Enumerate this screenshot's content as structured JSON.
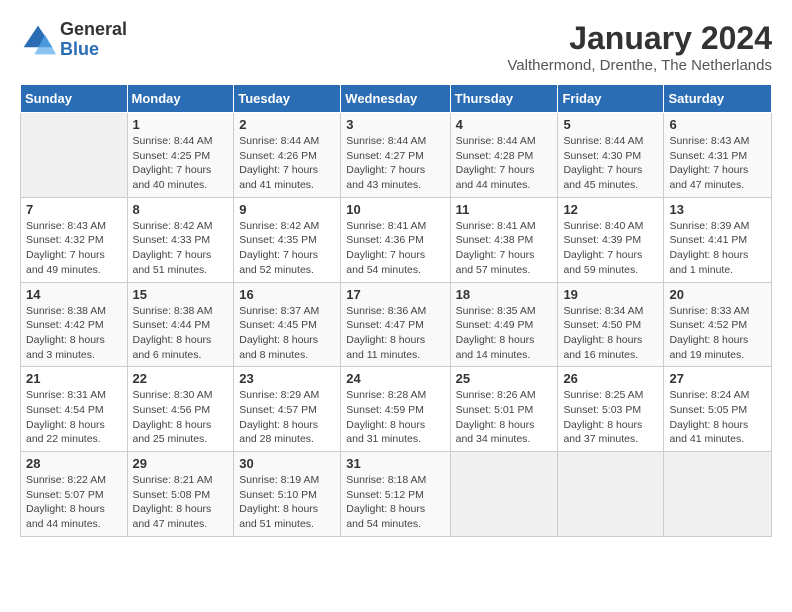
{
  "logo": {
    "general": "General",
    "blue": "Blue"
  },
  "title": "January 2024",
  "location": "Valthermond, Drenthe, The Netherlands",
  "days_of_week": [
    "Sunday",
    "Monday",
    "Tuesday",
    "Wednesday",
    "Thursday",
    "Friday",
    "Saturday"
  ],
  "weeks": [
    [
      {
        "day": "",
        "sunrise": "",
        "sunset": "",
        "daylight": ""
      },
      {
        "day": "1",
        "sunrise": "Sunrise: 8:44 AM",
        "sunset": "Sunset: 4:25 PM",
        "daylight": "Daylight: 7 hours and 40 minutes."
      },
      {
        "day": "2",
        "sunrise": "Sunrise: 8:44 AM",
        "sunset": "Sunset: 4:26 PM",
        "daylight": "Daylight: 7 hours and 41 minutes."
      },
      {
        "day": "3",
        "sunrise": "Sunrise: 8:44 AM",
        "sunset": "Sunset: 4:27 PM",
        "daylight": "Daylight: 7 hours and 43 minutes."
      },
      {
        "day": "4",
        "sunrise": "Sunrise: 8:44 AM",
        "sunset": "Sunset: 4:28 PM",
        "daylight": "Daylight: 7 hours and 44 minutes."
      },
      {
        "day": "5",
        "sunrise": "Sunrise: 8:44 AM",
        "sunset": "Sunset: 4:30 PM",
        "daylight": "Daylight: 7 hours and 45 minutes."
      },
      {
        "day": "6",
        "sunrise": "Sunrise: 8:43 AM",
        "sunset": "Sunset: 4:31 PM",
        "daylight": "Daylight: 7 hours and 47 minutes."
      }
    ],
    [
      {
        "day": "7",
        "sunrise": "Sunrise: 8:43 AM",
        "sunset": "Sunset: 4:32 PM",
        "daylight": "Daylight: 7 hours and 49 minutes."
      },
      {
        "day": "8",
        "sunrise": "Sunrise: 8:42 AM",
        "sunset": "Sunset: 4:33 PM",
        "daylight": "Daylight: 7 hours and 51 minutes."
      },
      {
        "day": "9",
        "sunrise": "Sunrise: 8:42 AM",
        "sunset": "Sunset: 4:35 PM",
        "daylight": "Daylight: 7 hours and 52 minutes."
      },
      {
        "day": "10",
        "sunrise": "Sunrise: 8:41 AM",
        "sunset": "Sunset: 4:36 PM",
        "daylight": "Daylight: 7 hours and 54 minutes."
      },
      {
        "day": "11",
        "sunrise": "Sunrise: 8:41 AM",
        "sunset": "Sunset: 4:38 PM",
        "daylight": "Daylight: 7 hours and 57 minutes."
      },
      {
        "day": "12",
        "sunrise": "Sunrise: 8:40 AM",
        "sunset": "Sunset: 4:39 PM",
        "daylight": "Daylight: 7 hours and 59 minutes."
      },
      {
        "day": "13",
        "sunrise": "Sunrise: 8:39 AM",
        "sunset": "Sunset: 4:41 PM",
        "daylight": "Daylight: 8 hours and 1 minute."
      }
    ],
    [
      {
        "day": "14",
        "sunrise": "Sunrise: 8:38 AM",
        "sunset": "Sunset: 4:42 PM",
        "daylight": "Daylight: 8 hours and 3 minutes."
      },
      {
        "day": "15",
        "sunrise": "Sunrise: 8:38 AM",
        "sunset": "Sunset: 4:44 PM",
        "daylight": "Daylight: 8 hours and 6 minutes."
      },
      {
        "day": "16",
        "sunrise": "Sunrise: 8:37 AM",
        "sunset": "Sunset: 4:45 PM",
        "daylight": "Daylight: 8 hours and 8 minutes."
      },
      {
        "day": "17",
        "sunrise": "Sunrise: 8:36 AM",
        "sunset": "Sunset: 4:47 PM",
        "daylight": "Daylight: 8 hours and 11 minutes."
      },
      {
        "day": "18",
        "sunrise": "Sunrise: 8:35 AM",
        "sunset": "Sunset: 4:49 PM",
        "daylight": "Daylight: 8 hours and 14 minutes."
      },
      {
        "day": "19",
        "sunrise": "Sunrise: 8:34 AM",
        "sunset": "Sunset: 4:50 PM",
        "daylight": "Daylight: 8 hours and 16 minutes."
      },
      {
        "day": "20",
        "sunrise": "Sunrise: 8:33 AM",
        "sunset": "Sunset: 4:52 PM",
        "daylight": "Daylight: 8 hours and 19 minutes."
      }
    ],
    [
      {
        "day": "21",
        "sunrise": "Sunrise: 8:31 AM",
        "sunset": "Sunset: 4:54 PM",
        "daylight": "Daylight: 8 hours and 22 minutes."
      },
      {
        "day": "22",
        "sunrise": "Sunrise: 8:30 AM",
        "sunset": "Sunset: 4:56 PM",
        "daylight": "Daylight: 8 hours and 25 minutes."
      },
      {
        "day": "23",
        "sunrise": "Sunrise: 8:29 AM",
        "sunset": "Sunset: 4:57 PM",
        "daylight": "Daylight: 8 hours and 28 minutes."
      },
      {
        "day": "24",
        "sunrise": "Sunrise: 8:28 AM",
        "sunset": "Sunset: 4:59 PM",
        "daylight": "Daylight: 8 hours and 31 minutes."
      },
      {
        "day": "25",
        "sunrise": "Sunrise: 8:26 AM",
        "sunset": "Sunset: 5:01 PM",
        "daylight": "Daylight: 8 hours and 34 minutes."
      },
      {
        "day": "26",
        "sunrise": "Sunrise: 8:25 AM",
        "sunset": "Sunset: 5:03 PM",
        "daylight": "Daylight: 8 hours and 37 minutes."
      },
      {
        "day": "27",
        "sunrise": "Sunrise: 8:24 AM",
        "sunset": "Sunset: 5:05 PM",
        "daylight": "Daylight: 8 hours and 41 minutes."
      }
    ],
    [
      {
        "day": "28",
        "sunrise": "Sunrise: 8:22 AM",
        "sunset": "Sunset: 5:07 PM",
        "daylight": "Daylight: 8 hours and 44 minutes."
      },
      {
        "day": "29",
        "sunrise": "Sunrise: 8:21 AM",
        "sunset": "Sunset: 5:08 PM",
        "daylight": "Daylight: 8 hours and 47 minutes."
      },
      {
        "day": "30",
        "sunrise": "Sunrise: 8:19 AM",
        "sunset": "Sunset: 5:10 PM",
        "daylight": "Daylight: 8 hours and 51 minutes."
      },
      {
        "day": "31",
        "sunrise": "Sunrise: 8:18 AM",
        "sunset": "Sunset: 5:12 PM",
        "daylight": "Daylight: 8 hours and 54 minutes."
      },
      {
        "day": "",
        "sunrise": "",
        "sunset": "",
        "daylight": ""
      },
      {
        "day": "",
        "sunrise": "",
        "sunset": "",
        "daylight": ""
      },
      {
        "day": "",
        "sunrise": "",
        "sunset": "",
        "daylight": ""
      }
    ]
  ]
}
